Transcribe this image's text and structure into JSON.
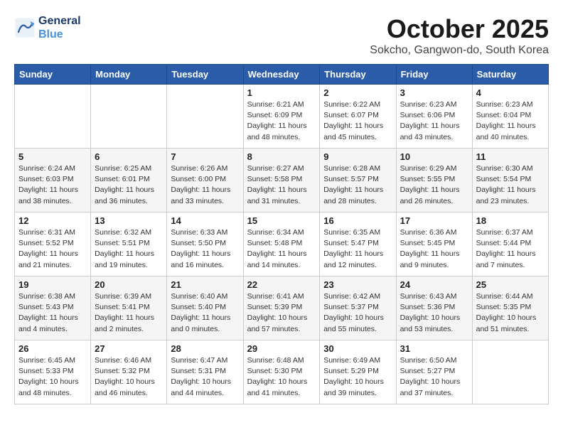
{
  "header": {
    "logo_line1": "General",
    "logo_line2": "Blue",
    "month": "October 2025",
    "location": "Sokcho, Gangwon-do, South Korea"
  },
  "weekdays": [
    "Sunday",
    "Monday",
    "Tuesday",
    "Wednesday",
    "Thursday",
    "Friday",
    "Saturday"
  ],
  "weeks": [
    [
      null,
      null,
      null,
      {
        "day": 1,
        "sunrise": "6:21 AM",
        "sunset": "6:09 PM",
        "daylight": "11 hours and 48 minutes."
      },
      {
        "day": 2,
        "sunrise": "6:22 AM",
        "sunset": "6:07 PM",
        "daylight": "11 hours and 45 minutes."
      },
      {
        "day": 3,
        "sunrise": "6:23 AM",
        "sunset": "6:06 PM",
        "daylight": "11 hours and 43 minutes."
      },
      {
        "day": 4,
        "sunrise": "6:23 AM",
        "sunset": "6:04 PM",
        "daylight": "11 hours and 40 minutes."
      }
    ],
    [
      {
        "day": 5,
        "sunrise": "6:24 AM",
        "sunset": "6:03 PM",
        "daylight": "11 hours and 38 minutes."
      },
      {
        "day": 6,
        "sunrise": "6:25 AM",
        "sunset": "6:01 PM",
        "daylight": "11 hours and 36 minutes."
      },
      {
        "day": 7,
        "sunrise": "6:26 AM",
        "sunset": "6:00 PM",
        "daylight": "11 hours and 33 minutes."
      },
      {
        "day": 8,
        "sunrise": "6:27 AM",
        "sunset": "5:58 PM",
        "daylight": "11 hours and 31 minutes."
      },
      {
        "day": 9,
        "sunrise": "6:28 AM",
        "sunset": "5:57 PM",
        "daylight": "11 hours and 28 minutes."
      },
      {
        "day": 10,
        "sunrise": "6:29 AM",
        "sunset": "5:55 PM",
        "daylight": "11 hours and 26 minutes."
      },
      {
        "day": 11,
        "sunrise": "6:30 AM",
        "sunset": "5:54 PM",
        "daylight": "11 hours and 23 minutes."
      }
    ],
    [
      {
        "day": 12,
        "sunrise": "6:31 AM",
        "sunset": "5:52 PM",
        "daylight": "11 hours and 21 minutes."
      },
      {
        "day": 13,
        "sunrise": "6:32 AM",
        "sunset": "5:51 PM",
        "daylight": "11 hours and 19 minutes."
      },
      {
        "day": 14,
        "sunrise": "6:33 AM",
        "sunset": "5:50 PM",
        "daylight": "11 hours and 16 minutes."
      },
      {
        "day": 15,
        "sunrise": "6:34 AM",
        "sunset": "5:48 PM",
        "daylight": "11 hours and 14 minutes."
      },
      {
        "day": 16,
        "sunrise": "6:35 AM",
        "sunset": "5:47 PM",
        "daylight": "11 hours and 12 minutes."
      },
      {
        "day": 17,
        "sunrise": "6:36 AM",
        "sunset": "5:45 PM",
        "daylight": "11 hours and 9 minutes."
      },
      {
        "day": 18,
        "sunrise": "6:37 AM",
        "sunset": "5:44 PM",
        "daylight": "11 hours and 7 minutes."
      }
    ],
    [
      {
        "day": 19,
        "sunrise": "6:38 AM",
        "sunset": "5:43 PM",
        "daylight": "11 hours and 4 minutes."
      },
      {
        "day": 20,
        "sunrise": "6:39 AM",
        "sunset": "5:41 PM",
        "daylight": "11 hours and 2 minutes."
      },
      {
        "day": 21,
        "sunrise": "6:40 AM",
        "sunset": "5:40 PM",
        "daylight": "11 hours and 0 minutes."
      },
      {
        "day": 22,
        "sunrise": "6:41 AM",
        "sunset": "5:39 PM",
        "daylight": "10 hours and 57 minutes."
      },
      {
        "day": 23,
        "sunrise": "6:42 AM",
        "sunset": "5:37 PM",
        "daylight": "10 hours and 55 minutes."
      },
      {
        "day": 24,
        "sunrise": "6:43 AM",
        "sunset": "5:36 PM",
        "daylight": "10 hours and 53 minutes."
      },
      {
        "day": 25,
        "sunrise": "6:44 AM",
        "sunset": "5:35 PM",
        "daylight": "10 hours and 51 minutes."
      }
    ],
    [
      {
        "day": 26,
        "sunrise": "6:45 AM",
        "sunset": "5:33 PM",
        "daylight": "10 hours and 48 minutes."
      },
      {
        "day": 27,
        "sunrise": "6:46 AM",
        "sunset": "5:32 PM",
        "daylight": "10 hours and 46 minutes."
      },
      {
        "day": 28,
        "sunrise": "6:47 AM",
        "sunset": "5:31 PM",
        "daylight": "10 hours and 44 minutes."
      },
      {
        "day": 29,
        "sunrise": "6:48 AM",
        "sunset": "5:30 PM",
        "daylight": "10 hours and 41 minutes."
      },
      {
        "day": 30,
        "sunrise": "6:49 AM",
        "sunset": "5:29 PM",
        "daylight": "10 hours and 39 minutes."
      },
      {
        "day": 31,
        "sunrise": "6:50 AM",
        "sunset": "5:27 PM",
        "daylight": "10 hours and 37 minutes."
      },
      null
    ]
  ]
}
